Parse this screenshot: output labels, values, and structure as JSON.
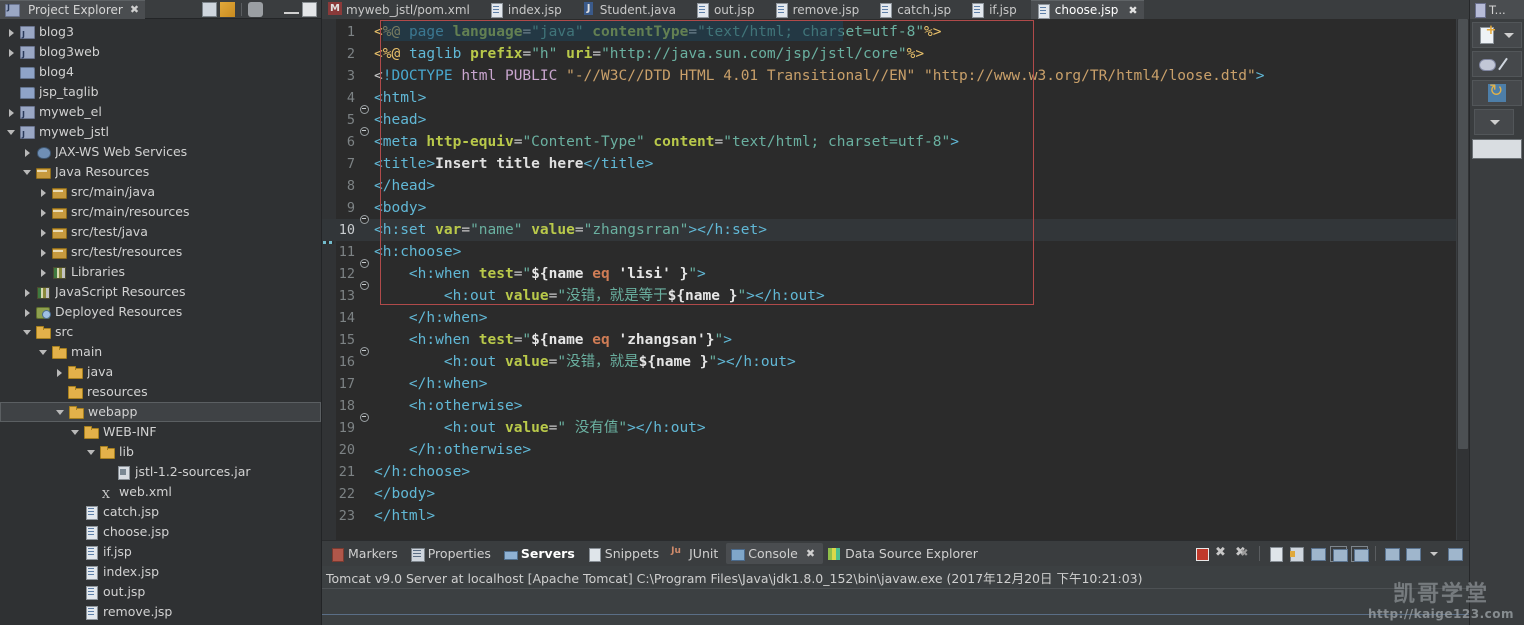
{
  "explorer": {
    "tab_label": "Project Explorer",
    "tab_close": "✖",
    "tools": [
      "collapse-all-icon",
      "link-with-editor-icon",
      "view-menu-icon",
      "minimize-icon",
      "maximize-icon"
    ],
    "tree": [
      {
        "label": "blog3",
        "depth": 0,
        "twisty": "closed",
        "icon": "project-icon"
      },
      {
        "label": "blog3web",
        "depth": 0,
        "twisty": "closed",
        "icon": "project-icon"
      },
      {
        "label": "blog4",
        "depth": 0,
        "twisty": "none",
        "icon": "folder-plain-icon"
      },
      {
        "label": "jsp_taglib",
        "depth": 0,
        "twisty": "none",
        "icon": "folder-plain-icon"
      },
      {
        "label": "myweb_el",
        "depth": 0,
        "twisty": "closed",
        "icon": "project-icon"
      },
      {
        "label": "myweb_jstl",
        "depth": 0,
        "twisty": "open",
        "icon": "project-icon"
      },
      {
        "label": "JAX-WS Web Services",
        "depth": 1,
        "twisty": "closed",
        "icon": "webservices-icon"
      },
      {
        "label": "Java Resources",
        "depth": 1,
        "twisty": "open",
        "icon": "source-folder-icon"
      },
      {
        "label": "src/main/java",
        "depth": 2,
        "twisty": "closed",
        "icon": "source-folder-icon"
      },
      {
        "label": "src/main/resources",
        "depth": 2,
        "twisty": "closed",
        "icon": "source-folder-icon"
      },
      {
        "label": "src/test/java",
        "depth": 2,
        "twisty": "closed",
        "icon": "source-folder-icon"
      },
      {
        "label": "src/test/resources",
        "depth": 2,
        "twisty": "closed",
        "icon": "source-folder-icon"
      },
      {
        "label": "Libraries",
        "depth": 2,
        "twisty": "closed",
        "icon": "libraries-icon"
      },
      {
        "label": "JavaScript Resources",
        "depth": 1,
        "twisty": "closed",
        "icon": "libraries-icon"
      },
      {
        "label": "Deployed Resources",
        "depth": 1,
        "twisty": "closed",
        "icon": "deployed-icon"
      },
      {
        "label": "src",
        "depth": 1,
        "twisty": "open",
        "icon": "folder-icon"
      },
      {
        "label": "main",
        "depth": 2,
        "twisty": "open",
        "icon": "folder-icon"
      },
      {
        "label": "java",
        "depth": 3,
        "twisty": "closed",
        "icon": "folder-icon"
      },
      {
        "label": "resources",
        "depth": 3,
        "twisty": "none",
        "icon": "folder-icon"
      },
      {
        "label": "webapp",
        "depth": 3,
        "twisty": "open",
        "icon": "folder-icon",
        "selected": true
      },
      {
        "label": "WEB-INF",
        "depth": 4,
        "twisty": "open",
        "icon": "folder-icon"
      },
      {
        "label": "lib",
        "depth": 5,
        "twisty": "open",
        "icon": "folder-icon"
      },
      {
        "label": "jstl-1.2-sources.jar",
        "depth": 6,
        "twisty": "none",
        "icon": "jar-icon"
      },
      {
        "label": "web.xml",
        "depth": 5,
        "twisty": "none",
        "icon": "xml-icon"
      },
      {
        "label": "catch.jsp",
        "depth": 4,
        "twisty": "none",
        "icon": "jsp-icon"
      },
      {
        "label": "choose.jsp",
        "depth": 4,
        "twisty": "none",
        "icon": "jsp-icon"
      },
      {
        "label": "if.jsp",
        "depth": 4,
        "twisty": "none",
        "icon": "jsp-icon"
      },
      {
        "label": "index.jsp",
        "depth": 4,
        "twisty": "none",
        "icon": "jsp-icon"
      },
      {
        "label": "out.jsp",
        "depth": 4,
        "twisty": "none",
        "icon": "jsp-icon"
      },
      {
        "label": "remove.jsp",
        "depth": 4,
        "twisty": "none",
        "icon": "jsp-icon"
      }
    ]
  },
  "editor": {
    "tabs": [
      {
        "label": "myweb_jstl/pom.xml",
        "icon": "maven-icon",
        "active": false
      },
      {
        "label": "index.jsp",
        "icon": "jsp-icon",
        "active": false
      },
      {
        "label": "Student.java",
        "icon": "java-icon",
        "active": false
      },
      {
        "label": "out.jsp",
        "icon": "jsp-icon",
        "active": false
      },
      {
        "label": "remove.jsp",
        "icon": "jsp-icon",
        "active": false
      },
      {
        "label": "catch.jsp",
        "icon": "jsp-icon",
        "active": false
      },
      {
        "label": "if.jsp",
        "icon": "jsp-icon",
        "active": false
      },
      {
        "label": "choose.jsp",
        "icon": "jsp-icon",
        "active": true,
        "close": "✖"
      }
    ],
    "file_name": "choose.jsp",
    "current_line": 10,
    "lines": [
      {
        "n": 1,
        "fold": false,
        "text": "<%@ page language=\"java\" contentType=\"text/html; charset=utf-8\"%>"
      },
      {
        "n": 2,
        "fold": false,
        "text": "<%@ taglib prefix=\"h\" uri=\"http://java.sun.com/jsp/jstl/core\"%>"
      },
      {
        "n": 3,
        "fold": false,
        "text": "<!DOCTYPE html PUBLIC \"-//W3C//DTD HTML 4.01 Transitional//EN\" \"http://www.w3.org/TR/html4/loose.dtd\">"
      },
      {
        "n": 4,
        "fold": true,
        "text": "<html>"
      },
      {
        "n": 5,
        "fold": true,
        "text": "<head>"
      },
      {
        "n": 6,
        "fold": false,
        "text": "<meta http-equiv=\"Content-Type\" content=\"text/html; charset=utf-8\">"
      },
      {
        "n": 7,
        "fold": false,
        "text": "<title>Insert title here</title>"
      },
      {
        "n": 8,
        "fold": false,
        "text": "</head>"
      },
      {
        "n": 9,
        "fold": true,
        "text": "<body>"
      },
      {
        "n": 10,
        "fold": false,
        "text": "<h:set var=\"name\" value=\"zhangsrran\"></h:set>"
      },
      {
        "n": 11,
        "fold": true,
        "text": "<h:choose>"
      },
      {
        "n": 12,
        "fold": true,
        "text": "    <h:when test=\"${name eq 'lisi' }\">"
      },
      {
        "n": 13,
        "fold": false,
        "text": "        <h:out value=\"没错，就是等于${name }\"></h:out>"
      },
      {
        "n": 14,
        "fold": false,
        "text": "    </h:when>"
      },
      {
        "n": 15,
        "fold": true,
        "text": "    <h:when test=\"${name eq 'zhangsan'}\">"
      },
      {
        "n": 16,
        "fold": false,
        "text": "        <h:out value=\"没错，就是${name }\"></h:out>"
      },
      {
        "n": 17,
        "fold": false,
        "text": "    </h:when>"
      },
      {
        "n": 18,
        "fold": true,
        "text": "    <h:otherwise>"
      },
      {
        "n": 19,
        "fold": false,
        "text": "        <h:out value=\" 没有值\"></h:out>"
      },
      {
        "n": 20,
        "fold": false,
        "text": "    </h:otherwise>"
      },
      {
        "n": 21,
        "fold": false,
        "text": "</h:choose>"
      },
      {
        "n": 22,
        "fold": false,
        "text": "</body>"
      },
      {
        "n": 23,
        "fold": false,
        "text": "</html>"
      }
    ]
  },
  "bottom": {
    "tabs": [
      {
        "label": "Markers",
        "icon": "markers-icon",
        "active": false
      },
      {
        "label": "Properties",
        "icon": "properties-icon",
        "active": false
      },
      {
        "label": "Servers",
        "icon": "servers-icon",
        "active": true
      },
      {
        "label": "Snippets",
        "icon": "snippets-icon",
        "active": false
      },
      {
        "label": "JUnit",
        "icon": "junit-icon",
        "active": false
      },
      {
        "label": "Console",
        "icon": "console-icon",
        "active": false,
        "selected": true,
        "close": "✖"
      },
      {
        "label": "Data Source Explorer",
        "icon": "data-source-icon",
        "active": false
      }
    ],
    "toolbar": [
      "terminate-icon",
      "remove-launch-icon",
      "remove-all-launches-icon",
      "clear-console-icon",
      "scroll-lock-icon",
      "show-console-icon",
      "pin-console-icon",
      "display-selected-console-icon",
      "open-console-icon",
      "console-dropdown-icon",
      "new-console-view-icon"
    ],
    "status_text": "Tomcat v9.0 Server at localhost [Apache Tomcat] C:\\Program Files\\Java\\jdk1.8.0_152\\bin\\javaw.exe (2017年12月20日 下午10:21:03)"
  },
  "right_panel": {
    "tab_label": "T...",
    "buttons": [
      "new-file-icon",
      "dropdown-icon",
      "package-icon",
      "wand-icon",
      "refresh-icon",
      "caret-down-icon"
    ]
  },
  "watermark": {
    "cn": "凯哥学堂",
    "url": "http://kaige123.com"
  },
  "colors": {
    "editor_bg": "#2b2b2b",
    "panel_bg": "#3c4042",
    "selection_border": "#b04a4a",
    "tag": "#61b8d6",
    "attr": "#b9c94a",
    "string": "#6ab0a0",
    "directive": "#e8c06a"
  }
}
